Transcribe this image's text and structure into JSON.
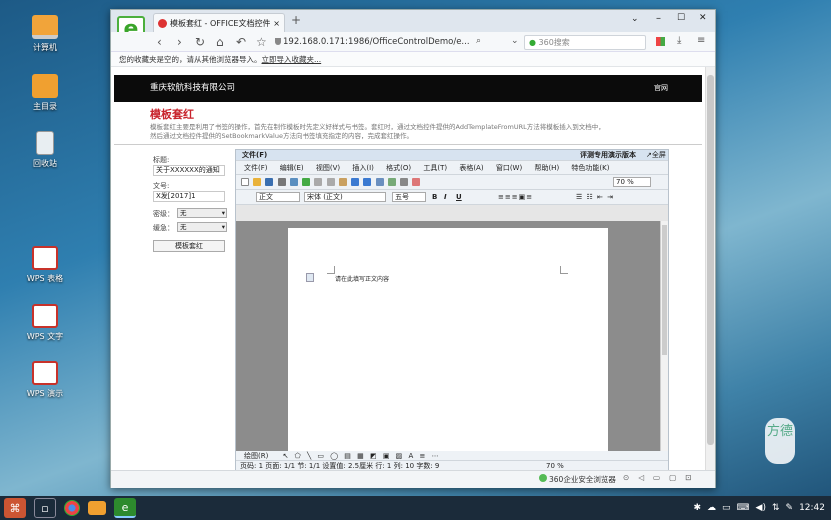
{
  "desktop": {
    "icons": [
      {
        "label": "计算机",
        "color": "#f1a43a"
      },
      {
        "label": "主目录",
        "color": "#f0a030"
      },
      {
        "label": "回收站",
        "color": "#e8eef2"
      },
      {
        "label": "WPS 表格",
        "color": "#c8322a"
      },
      {
        "label": "WPS 文字",
        "color": "#c8322a"
      },
      {
        "label": "WPS 演示",
        "color": "#c8322a"
      }
    ],
    "watermark": "方德"
  },
  "taskbar": {
    "time": "12:42"
  },
  "browser": {
    "tab_title": "模板套红 - OFFICE文档控件 ...",
    "tab_close": "×",
    "new_tab": "+",
    "url": "192.168.0.171:1986/OfficeControlDemo/e...",
    "search_placeholder": "360搜索",
    "bookmark_text": "您的收藏夹是空的，请从其他浏览器导入。",
    "bookmark_link": "立即导入收藏夹...",
    "status_security": "360企业安全浏览器",
    "window_controls": [
      "⌄",
      "–",
      "☐",
      "✕"
    ]
  },
  "page": {
    "company": "重庆软航科技有限公司",
    "official_site": "官网",
    "title": "模板套红",
    "desc1": "模板套红主要是利用了书签的操作，首先在制作模板时先定义好样式与书签。套红时，通过文档控件提供的AddTemplateFromURL方法将模板插入到文档中，",
    "desc2": "然后通过文档控件提供的SetBookmarkValue方法向书签填充指定的内容，完成套红操作。",
    "form": {
      "title_label": "标题:",
      "title_value": "关于XXXXXX的通知",
      "docno_label": "文号:",
      "docno_value": "X发[2017]1",
      "secret_label": "密级：",
      "secret_value": "无",
      "urgency_label": "缓急：",
      "urgency_value": "无",
      "button": "模板套红"
    }
  },
  "wps": {
    "file_menu": "文件(F)",
    "version_text": "评测专用演示版本",
    "maximize": "↗全屏",
    "menus": [
      "文件(F)",
      "编辑(E)",
      "视图(V)",
      "插入(I)",
      "格式(O)",
      "工具(T)",
      "表格(A)",
      "窗口(W)",
      "帮助(H)",
      "特色功能(K)"
    ],
    "zoom": "70 %",
    "style": "正文",
    "font": "宋体 (正文)",
    "size": "五号",
    "doc_text": "请在此填写正文内容",
    "draw_label": "绘图(R)",
    "status": "页码: 1   页面: 1/1   节: 1/1   设置值: 2.5厘米   行: 1  列: 10   字数: 9",
    "status_zoom": "70 %"
  }
}
